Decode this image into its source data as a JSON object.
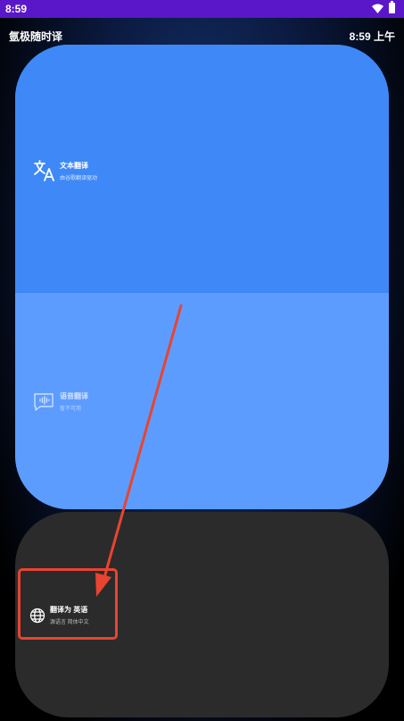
{
  "status_bar": {
    "time": "8:59"
  },
  "header": {
    "app_title": "氩极随时译",
    "clock": "8:59 上午"
  },
  "text_translate": {
    "label": "文本翻译",
    "sub": "由谷歌翻译驱动"
  },
  "voice_translate": {
    "label": "语音翻译",
    "sub": "暂不可用"
  },
  "translate_to": {
    "label": "翻译为 英语",
    "sub": "源语言 简体中文"
  },
  "colors": {
    "status_bar": "#5a17c9",
    "text_section": "#3e89f7",
    "voice_section": "#5d9cff",
    "bottom_card": "#2b2b2b",
    "annotation": "#e84431"
  }
}
